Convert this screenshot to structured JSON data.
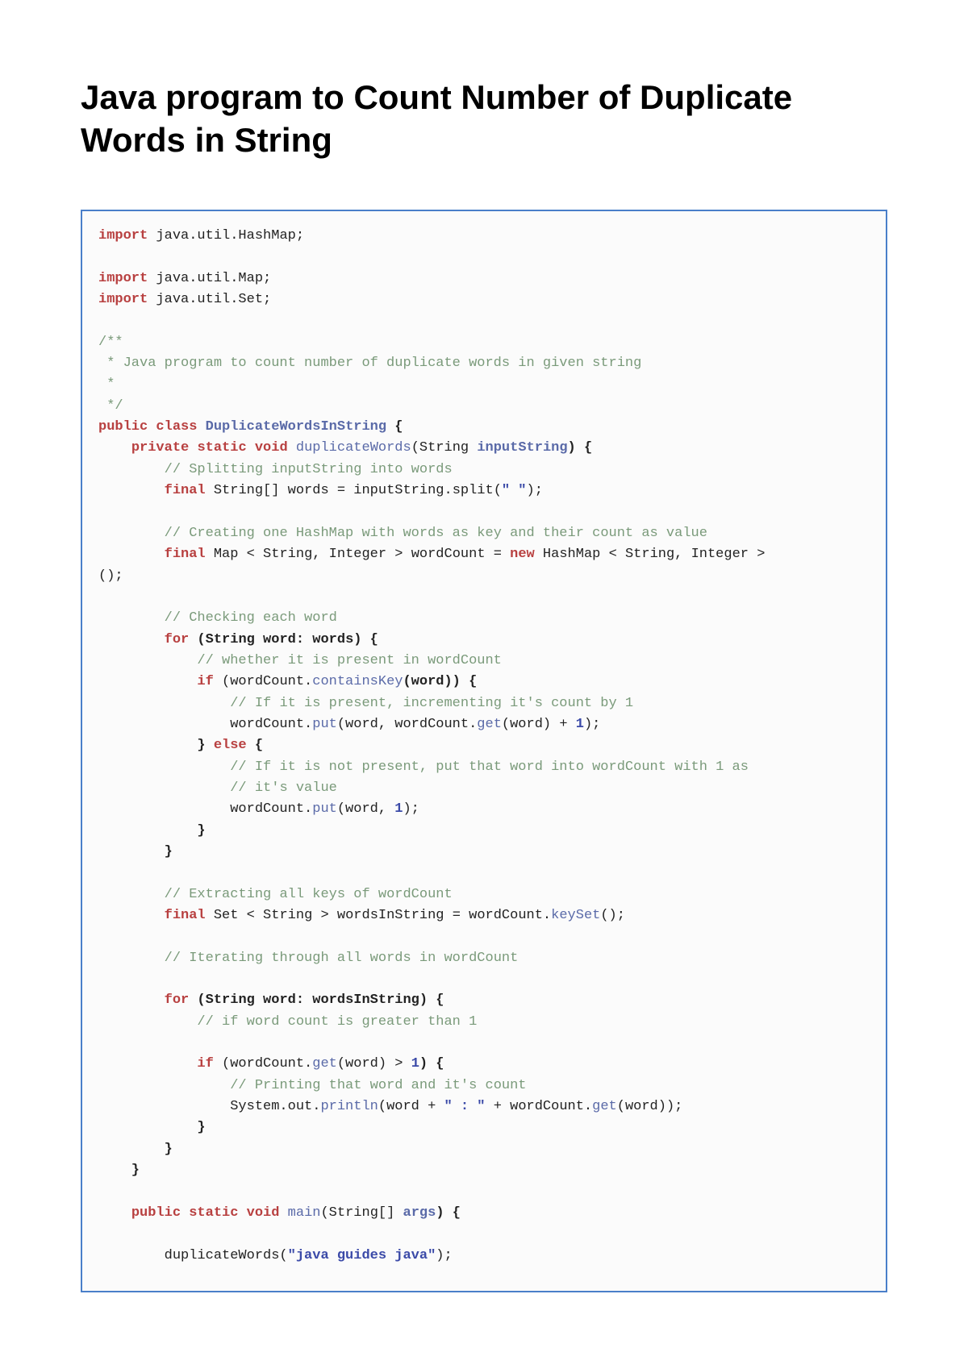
{
  "title": "Java program to Count Number of Duplicate Words in String",
  "code": {
    "tokens": [
      {
        "t": "import",
        "c": "kw"
      },
      {
        "t": " java.util.HashMap;\n",
        "c": "id"
      },
      {
        "t": "\n",
        "c": "id"
      },
      {
        "t": "import",
        "c": "kw"
      },
      {
        "t": " java.util.Map;\n",
        "c": "id"
      },
      {
        "t": "import",
        "c": "kw"
      },
      {
        "t": " java.util.Set;\n",
        "c": "id"
      },
      {
        "t": "\n",
        "c": "id"
      },
      {
        "t": "/**\n",
        "c": "cm"
      },
      {
        "t": " * Java program to count number of duplicate words in given string\n",
        "c": "cm"
      },
      {
        "t": " *\n",
        "c": "cm"
      },
      {
        "t": " */\n",
        "c": "cm"
      },
      {
        "t": "public",
        "c": "kw"
      },
      {
        "t": " ",
        "c": "id"
      },
      {
        "t": "class",
        "c": "kw"
      },
      {
        "t": " ",
        "c": "id"
      },
      {
        "t": "DuplicateWordsInString",
        "c": "cls"
      },
      {
        "t": " {\n",
        "c": "br"
      },
      {
        "t": "    ",
        "c": "id"
      },
      {
        "t": "private",
        "c": "kw"
      },
      {
        "t": " ",
        "c": "id"
      },
      {
        "t": "static",
        "c": "kw"
      },
      {
        "t": " ",
        "c": "id"
      },
      {
        "t": "void",
        "c": "kw"
      },
      {
        "t": " ",
        "c": "id"
      },
      {
        "t": "duplicateWords",
        "c": "fn"
      },
      {
        "t": "(String ",
        "c": "id"
      },
      {
        "t": "inputString",
        "c": "cls"
      },
      {
        "t": ") {\n",
        "c": "br"
      },
      {
        "t": "        ",
        "c": "id"
      },
      {
        "t": "// Splitting inputString into words\n",
        "c": "cm"
      },
      {
        "t": "        ",
        "c": "id"
      },
      {
        "t": "final",
        "c": "kw"
      },
      {
        "t": " String[] words = inputString.split(",
        "c": "id"
      },
      {
        "t": "\" \"",
        "c": "st"
      },
      {
        "t": ");\n",
        "c": "id"
      },
      {
        "t": "\n",
        "c": "id"
      },
      {
        "t": "        ",
        "c": "id"
      },
      {
        "t": "// Creating one HashMap with words as key and their count as value\n",
        "c": "cm"
      },
      {
        "t": "        ",
        "c": "id"
      },
      {
        "t": "final",
        "c": "kw"
      },
      {
        "t": " Map ",
        "c": "id"
      },
      {
        "t": "<",
        "c": "id"
      },
      {
        "t": " String, Integer ",
        "c": "id"
      },
      {
        "t": ">",
        "c": "id"
      },
      {
        "t": " wordCount = ",
        "c": "id"
      },
      {
        "t": "new",
        "c": "kw"
      },
      {
        "t": " HashMap ",
        "c": "id"
      },
      {
        "t": "<",
        "c": "id"
      },
      {
        "t": " String, Integer ",
        "c": "id"
      },
      {
        "t": ">\n",
        "c": "id"
      },
      {
        "t": "();\n",
        "c": "id"
      },
      {
        "t": "\n",
        "c": "id"
      },
      {
        "t": "        ",
        "c": "id"
      },
      {
        "t": "// Checking each word\n",
        "c": "cm"
      },
      {
        "t": "        ",
        "c": "id"
      },
      {
        "t": "for",
        "c": "kw"
      },
      {
        "t": " (String word: words) {\n",
        "c": "br"
      },
      {
        "t": "            ",
        "c": "id"
      },
      {
        "t": "// whether it is present in wordCount\n",
        "c": "cm"
      },
      {
        "t": "            ",
        "c": "id"
      },
      {
        "t": "if",
        "c": "kw"
      },
      {
        "t": " (wordCount.",
        "c": "id"
      },
      {
        "t": "containsKey",
        "c": "fn"
      },
      {
        "t": "(word)) {\n",
        "c": "br"
      },
      {
        "t": "                ",
        "c": "id"
      },
      {
        "t": "// If it is present, incrementing it's count by 1\n",
        "c": "cm"
      },
      {
        "t": "                wordCount.",
        "c": "id"
      },
      {
        "t": "put",
        "c": "fn"
      },
      {
        "t": "(word, wordCount.",
        "c": "id"
      },
      {
        "t": "get",
        "c": "fn"
      },
      {
        "t": "(word) + ",
        "c": "id"
      },
      {
        "t": "1",
        "c": "nm"
      },
      {
        "t": ");\n",
        "c": "id"
      },
      {
        "t": "            } ",
        "c": "br"
      },
      {
        "t": "else",
        "c": "kw"
      },
      {
        "t": " {\n",
        "c": "br"
      },
      {
        "t": "                ",
        "c": "id"
      },
      {
        "t": "// If it is not present, put that word into wordCount with 1 as\n",
        "c": "cm"
      },
      {
        "t": "                ",
        "c": "id"
      },
      {
        "t": "// it's value\n",
        "c": "cm"
      },
      {
        "t": "                wordCount.",
        "c": "id"
      },
      {
        "t": "put",
        "c": "fn"
      },
      {
        "t": "(word, ",
        "c": "id"
      },
      {
        "t": "1",
        "c": "nm"
      },
      {
        "t": ");\n",
        "c": "id"
      },
      {
        "t": "            }\n",
        "c": "br"
      },
      {
        "t": "        }\n",
        "c": "br"
      },
      {
        "t": "\n",
        "c": "id"
      },
      {
        "t": "        ",
        "c": "id"
      },
      {
        "t": "// Extracting all keys of wordCount\n",
        "c": "cm"
      },
      {
        "t": "        ",
        "c": "id"
      },
      {
        "t": "final",
        "c": "kw"
      },
      {
        "t": " Set ",
        "c": "id"
      },
      {
        "t": "<",
        "c": "id"
      },
      {
        "t": " String ",
        "c": "id"
      },
      {
        "t": ">",
        "c": "id"
      },
      {
        "t": " wordsInString = wordCount.",
        "c": "id"
      },
      {
        "t": "keySet",
        "c": "fn"
      },
      {
        "t": "();\n",
        "c": "id"
      },
      {
        "t": "\n",
        "c": "id"
      },
      {
        "t": "        ",
        "c": "id"
      },
      {
        "t": "// Iterating through all words in wordCount\n",
        "c": "cm"
      },
      {
        "t": "\n",
        "c": "id"
      },
      {
        "t": "        ",
        "c": "id"
      },
      {
        "t": "for",
        "c": "kw"
      },
      {
        "t": " (String word: wordsInString) {\n",
        "c": "br"
      },
      {
        "t": "            ",
        "c": "id"
      },
      {
        "t": "// if word count is greater than 1\n",
        "c": "cm"
      },
      {
        "t": "\n",
        "c": "id"
      },
      {
        "t": "            ",
        "c": "id"
      },
      {
        "t": "if",
        "c": "kw"
      },
      {
        "t": " (wordCount.",
        "c": "id"
      },
      {
        "t": "get",
        "c": "fn"
      },
      {
        "t": "(word) > ",
        "c": "id"
      },
      {
        "t": "1",
        "c": "nm"
      },
      {
        "t": ") {\n",
        "c": "br"
      },
      {
        "t": "                ",
        "c": "id"
      },
      {
        "t": "// Printing that word and it's count\n",
        "c": "cm"
      },
      {
        "t": "                System.out.",
        "c": "id"
      },
      {
        "t": "println",
        "c": "fn"
      },
      {
        "t": "(word + ",
        "c": "id"
      },
      {
        "t": "\" : \"",
        "c": "st"
      },
      {
        "t": " + wordCount.",
        "c": "id"
      },
      {
        "t": "get",
        "c": "fn"
      },
      {
        "t": "(word));\n",
        "c": "id"
      },
      {
        "t": "            }\n",
        "c": "br"
      },
      {
        "t": "        }\n",
        "c": "br"
      },
      {
        "t": "    }\n",
        "c": "br"
      },
      {
        "t": "\n",
        "c": "id"
      },
      {
        "t": "    ",
        "c": "id"
      },
      {
        "t": "public",
        "c": "kw"
      },
      {
        "t": " ",
        "c": "id"
      },
      {
        "t": "static",
        "c": "kw"
      },
      {
        "t": " ",
        "c": "id"
      },
      {
        "t": "void",
        "c": "kw"
      },
      {
        "t": " ",
        "c": "id"
      },
      {
        "t": "main",
        "c": "fn"
      },
      {
        "t": "(String[] ",
        "c": "id"
      },
      {
        "t": "args",
        "c": "cls"
      },
      {
        "t": ") {\n",
        "c": "br"
      },
      {
        "t": "\n",
        "c": "id"
      },
      {
        "t": "        duplicateWords(",
        "c": "id"
      },
      {
        "t": "\"java guides java\"",
        "c": "st"
      },
      {
        "t": ");\n",
        "c": "id"
      }
    ]
  }
}
